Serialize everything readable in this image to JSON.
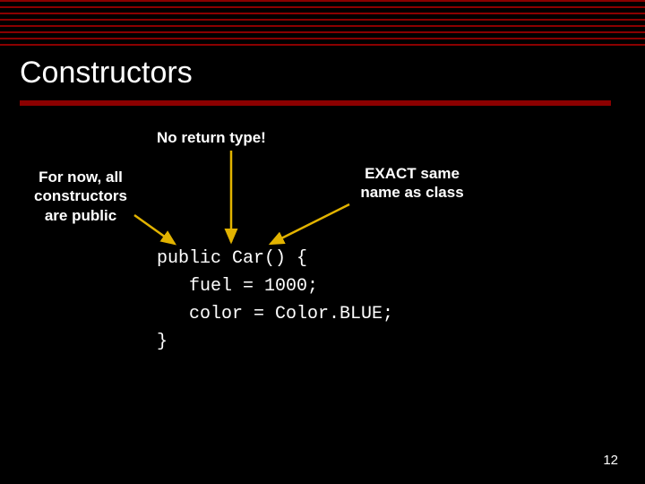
{
  "title": "Constructors",
  "annotations": {
    "top": "No return type!",
    "left_line1": "For now, all",
    "left_line2": "constructors",
    "left_line3": "are public",
    "right_line1": "EXACT same",
    "right_line2": "name as class"
  },
  "code": {
    "line1": "public Car() {",
    "line2": "   fuel = 1000;",
    "line3": "   color = Color.BLUE;",
    "line4": "}"
  },
  "page_number": "12",
  "arrow_color": "#e2b300"
}
